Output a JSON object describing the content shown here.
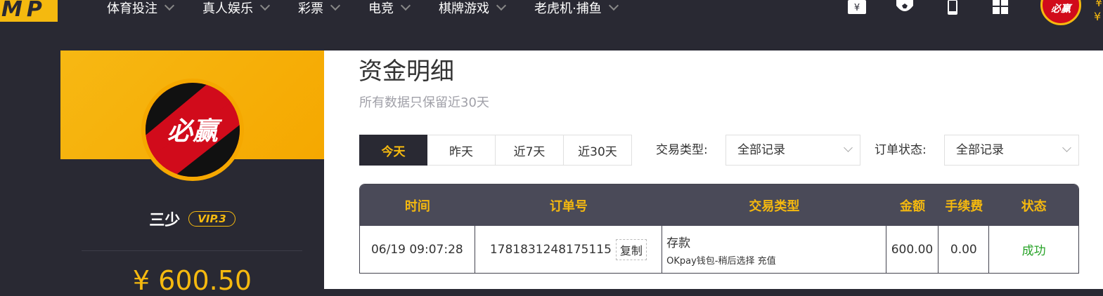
{
  "header": {
    "logo_text": "MP",
    "nav": [
      {
        "label": "体育投注"
      },
      {
        "label": "真人娱乐"
      },
      {
        "label": "彩票"
      },
      {
        "label": "电竞"
      },
      {
        "label": "棋牌游戏"
      },
      {
        "label": "老虎机·捕鱼"
      }
    ],
    "icons": [
      "wallet-yen-icon",
      "football-icon",
      "mobile-icon",
      "grid-icon"
    ],
    "avatar_text": "必赢",
    "balance_glyph": "¥"
  },
  "profile": {
    "brand_text": "必赢",
    "username": "三少",
    "vip": "VIP.3",
    "balance": "¥ 600.50"
  },
  "main": {
    "title": "资金明细",
    "subtitle": "所有数据只保留近30天",
    "tabs": [
      {
        "label": "今天",
        "active": true
      },
      {
        "label": "昨天",
        "active": false
      },
      {
        "label": "近7天",
        "active": false
      },
      {
        "label": "近30天",
        "active": false
      }
    ],
    "type_filter": {
      "label": "交易类型:",
      "value": "全部记录"
    },
    "status_filter": {
      "label": "订单状态:",
      "value": "全部记录"
    },
    "table": {
      "headers": [
        "时间",
        "订单号",
        "交易类型",
        "金额",
        "手续费",
        "状态"
      ],
      "rows": [
        {
          "time": "06/19 09:07:28",
          "order_no": "1781831248175115",
          "copy_label": "复制",
          "type": "存款",
          "type_detail": "OKpay钱包-稍后选择 充值",
          "amount": "600.00",
          "fee": "0.00",
          "status": "成功"
        }
      ]
    }
  },
  "colors": {
    "accent": "#f5b90f",
    "dark": "#292933",
    "success": "#27a327",
    "brand_red": "#d10b1b"
  }
}
